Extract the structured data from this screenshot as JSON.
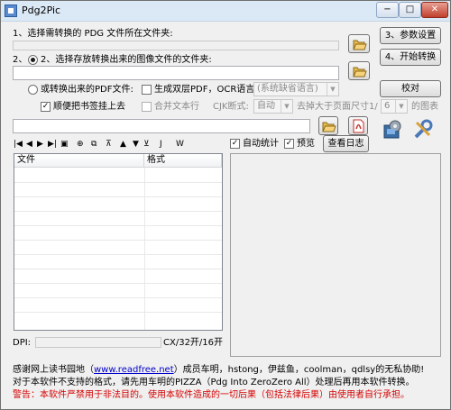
{
  "window": {
    "title": "Pdg2Pic",
    "controls": {
      "minimize": "−",
      "maximize": "□",
      "close": "✕"
    }
  },
  "step1": {
    "label": "1、选择需转换的 PDG 文件所在文件夹:"
  },
  "step2": {
    "label": "2、选择存放转换出来的图像文件的文件夹:"
  },
  "buttons": {
    "params": "3、参数设置",
    "start": "4、开始转换",
    "proof": "校对",
    "log": "查看日志"
  },
  "pdf_option": {
    "label": "或转换出来的PDF文件:"
  },
  "options": {
    "double_layer": "生成双层PDF，OCR语言:",
    "ocr_language": "(系统缺省语言)",
    "merge_text": "合并文本行",
    "cjk_label": "CJK断式:",
    "cjk_value": "自动",
    "remove_label": "去掉大于页面尺寸1/",
    "remove_value": "6",
    "remove_suffix": "的图表",
    "bookmark": "顺便把书签挂上去"
  },
  "toolbar": {
    "auto_stats": "自动统计",
    "preview": "预览",
    "icons": [
      "first-icon",
      "prev-icon",
      "next-icon",
      "last-icon",
      "export-icon",
      "import-icon",
      "copy-icon",
      "sort-top-icon",
      "sort-up-icon",
      "sort-down-icon",
      "sort-bottom-icon",
      "jump-icon",
      "edit-icon"
    ],
    "glyphs": [
      "|◀",
      "◀",
      "▶",
      "▶|",
      "▣",
      "⊕",
      "⧉",
      "⊼",
      "▲",
      "▼",
      "⊻",
      "J",
      "W"
    ]
  },
  "file_list": {
    "columns": [
      "文件",
      "格式"
    ]
  },
  "status": {
    "dpi_label": "DPI:",
    "paper_size": "CX/32开/16开"
  },
  "footer": {
    "thanks_prefix": "感谢网上读书园地（",
    "thanks_link": "www.readfree.net",
    "thanks_suffix": "）成员车明，hstong，伊兹鱼，coolman，qdlsy的无私协助!",
    "note": "对于本软件不支持的格式，请先用车明的PIZZA（Pdg Into ZeroZero All）处理后再用本软件转换。",
    "warning": "警告：本软件严禁用于非法目的。使用本软件造成的一切后果（包括法律后果）由使用者自行承担。"
  },
  "colors": {
    "warning": "#d40000",
    "link": "#0000cc",
    "folder_icon": "#e8b84a"
  }
}
